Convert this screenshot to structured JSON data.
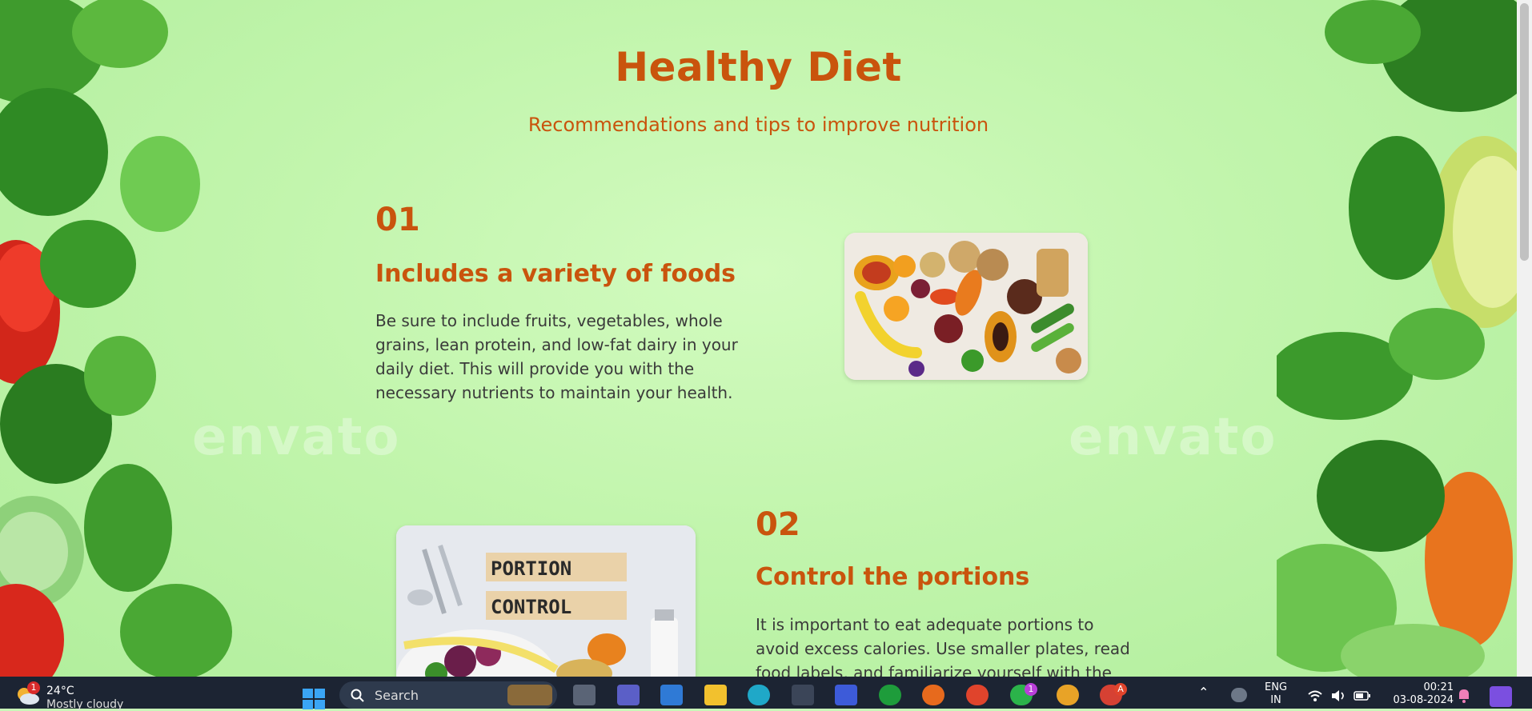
{
  "header": {
    "title": "Healthy Diet",
    "subtitle": "Recommendations and tips to improve nutrition"
  },
  "sections": [
    {
      "number": "01",
      "title": "Includes a variety of foods",
      "text": "Be sure to include fruits, vegetables, whole grains, lean protein, and low-fat dairy in your daily diet. This will provide you with the necessary nutrients to maintain your health."
    },
    {
      "number": "02",
      "title": "Control the portions",
      "text": "It is important to eat adequate portions to avoid excess calories. Use smaller plates, read food labels, and familiarize yourself with the",
      "image_words": [
        "PORTION",
        "CONTROL"
      ]
    }
  ],
  "watermark": "envato",
  "taskbar": {
    "weather_temp": "24°C",
    "weather_desc": "Mostly cloudy",
    "weather_badge": "1",
    "search_placeholder": "Search",
    "whatsapp_badge": "1",
    "chrome_badge": "A",
    "lang_line1": "ENG",
    "lang_line2": "IN",
    "time": "00:21",
    "date": "03-08-2024"
  },
  "colors": {
    "accent": "#c9540d",
    "background": "#c2f5ad",
    "taskbar": "#1c2433"
  }
}
